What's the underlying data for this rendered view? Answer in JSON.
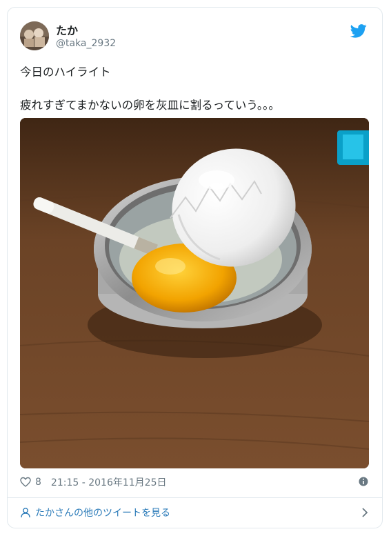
{
  "tweet": {
    "author_name": "たか",
    "author_handle": "@taka_2932",
    "text_line1": "今日のハイライト",
    "text_line2": "疲れすぎてまかないの卵を灰皿に割るっていう。。。",
    "likes": "8",
    "timestamp": "21:15 - 2016年11月25日"
  },
  "footer": {
    "more_link": "たかさんの他のツイートを見る"
  },
  "icons": {
    "brand": "twitter-bird-icon",
    "like": "heart-icon",
    "info": "info-icon",
    "profile": "person-icon",
    "arrow": "chevron-right-icon"
  },
  "colors": {
    "twitter_blue": "#1da1f2",
    "link_blue": "#2b7bb9",
    "muted_text": "#697882",
    "border": "#e1e8ed"
  }
}
